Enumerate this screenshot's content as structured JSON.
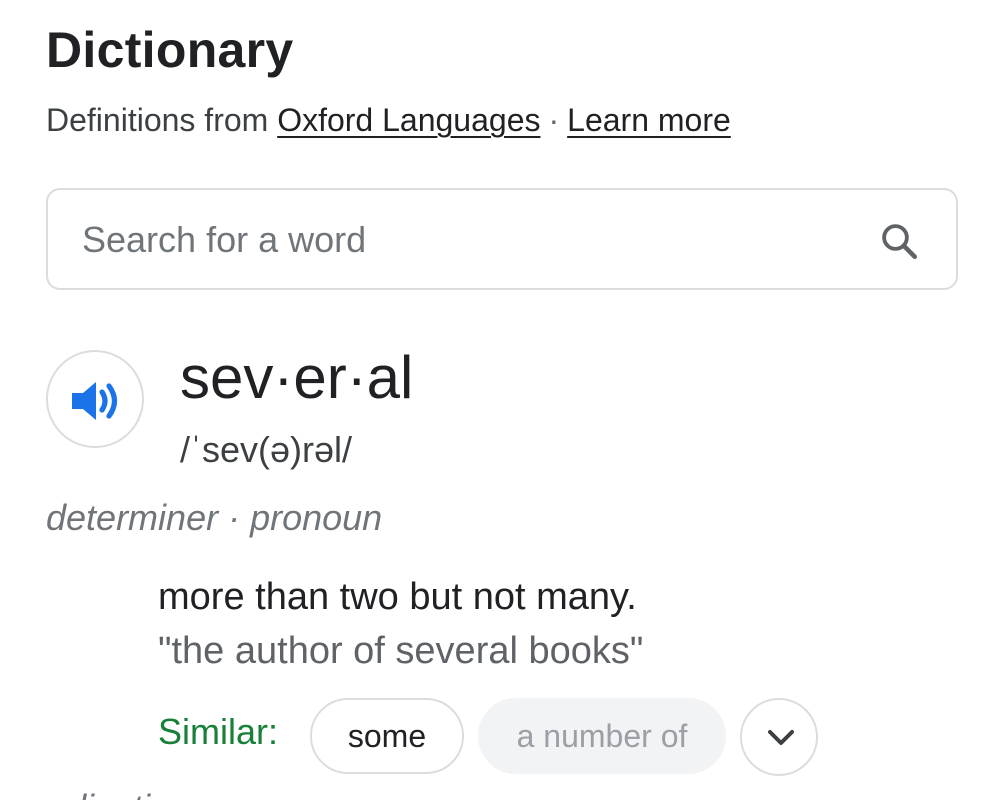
{
  "header": {
    "title": "Dictionary",
    "attribution_prefix": "Definitions from",
    "source_link": "Oxford Languages",
    "separator": "·",
    "learn_more": "Learn more"
  },
  "search": {
    "placeholder": "Search for a word",
    "value": "",
    "icon": "search-icon"
  },
  "entry": {
    "audio_icon": "speaker-icon",
    "headword": "sev·er·al",
    "phonetic": "/ˈsev(ə)rəl/",
    "part_of_speech": "determiner · pronoun",
    "definition": "more than two but not many.",
    "example": "\"the author of several books\"",
    "similar_label": "Similar:",
    "similar": [
      "some",
      "a number of"
    ],
    "expand_icon": "chevron-down-icon",
    "next_part_of_speech": "adjective"
  },
  "colors": {
    "accent_blue": "#1a73e8",
    "similar_green": "#188038",
    "border": "#dadce0",
    "muted_chip_bg": "#f1f3f4"
  }
}
